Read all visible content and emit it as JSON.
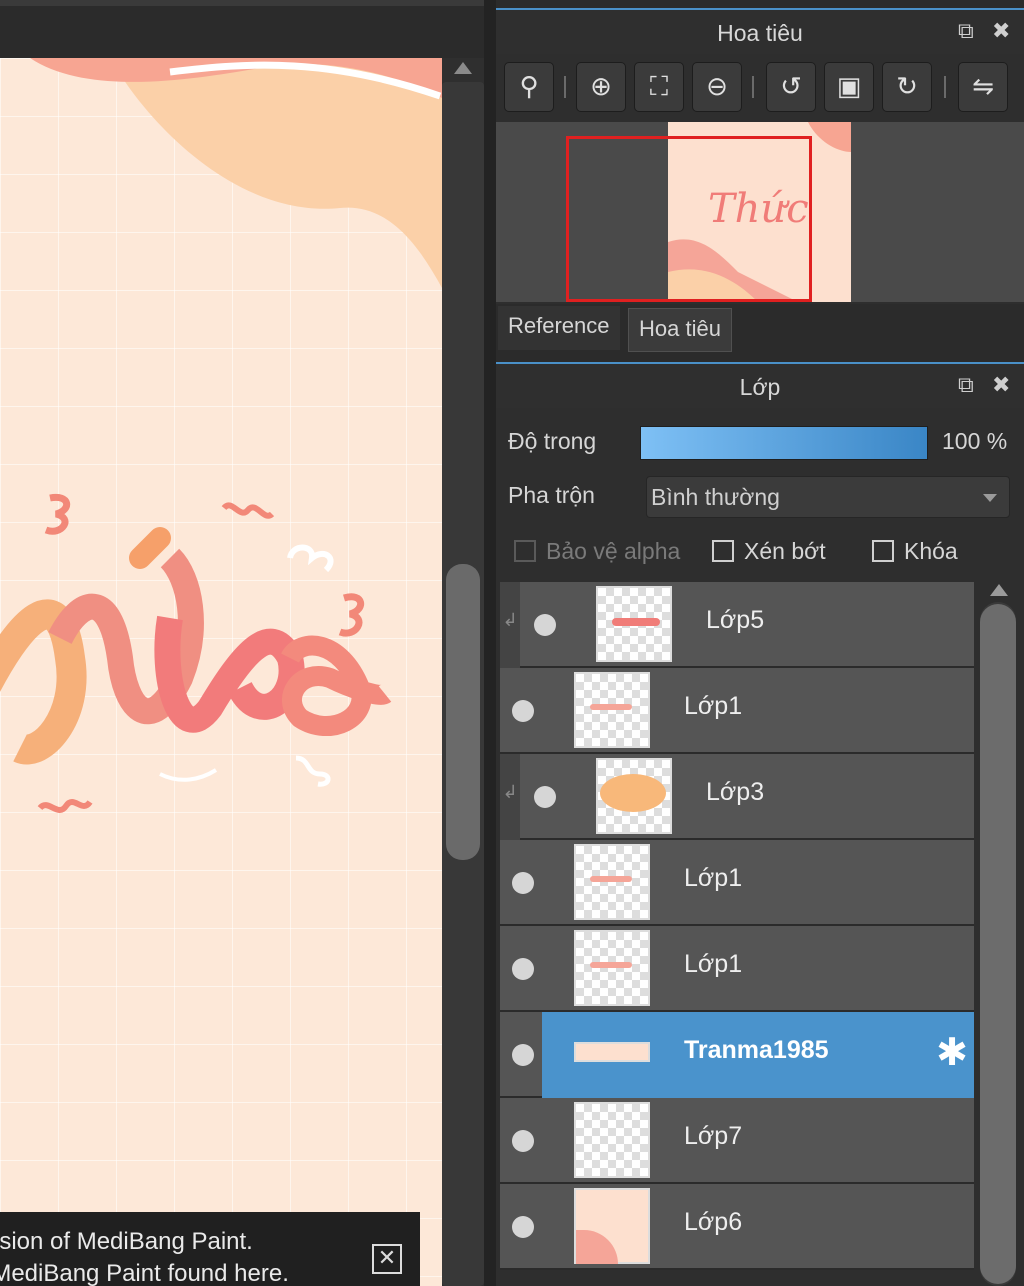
{
  "navigator": {
    "title": "Hoa tiêu",
    "detach_icon": "detach-icon",
    "close_icon": "close-icon",
    "tools": [
      {
        "name": "actual-size-icon",
        "glyph": "🔍"
      },
      {
        "name": "zoom-in-icon",
        "glyph": "⊕"
      },
      {
        "name": "fit-window-icon",
        "glyph": "⛶"
      },
      {
        "name": "zoom-out-icon",
        "glyph": "⊖"
      },
      {
        "name": "rotate-left-icon",
        "glyph": "↺"
      },
      {
        "name": "reset-view-icon",
        "glyph": "▣"
      },
      {
        "name": "rotate-right-icon",
        "glyph": "↻"
      },
      {
        "name": "flip-horizontal-icon",
        "glyph": "⇋"
      }
    ],
    "tabs": [
      {
        "label": "Reference"
      },
      {
        "label": "Hoa tiêu"
      }
    ],
    "thumbnail_text": "Thức"
  },
  "layers_panel": {
    "title": "Lớp",
    "opacity_label": "Độ trong",
    "opacity_value": "100 %",
    "opacity_fraction": 1.0,
    "blend_label": "Pha trộn",
    "blend_value": "Bình thường",
    "checkboxes": {
      "alpha": "Bảo vệ alpha",
      "clip": "Xén bớt",
      "lock": "Khóa"
    },
    "layers": [
      {
        "name": "Lớp5",
        "clipped": true
      },
      {
        "name": "Lớp1",
        "clipped": false
      },
      {
        "name": "Lớp3",
        "clipped": true
      },
      {
        "name": "Lớp1",
        "clipped": false
      },
      {
        "name": "Lớp1",
        "clipped": false
      },
      {
        "name": "Tranma1985",
        "clipped": false,
        "active": true
      },
      {
        "name": "Lớp7",
        "clipped": false
      },
      {
        "name": "Lớp6",
        "clipped": false
      }
    ]
  },
  "notice": {
    "line1": "ersion of MediBang Paint.",
    "line2": "f MediBang Paint found here.",
    "close_glyph": "✕"
  },
  "colors": {
    "accent": "#4a93cc",
    "selection_red": "#e02020",
    "canvas_bg": "#fde8d8"
  }
}
